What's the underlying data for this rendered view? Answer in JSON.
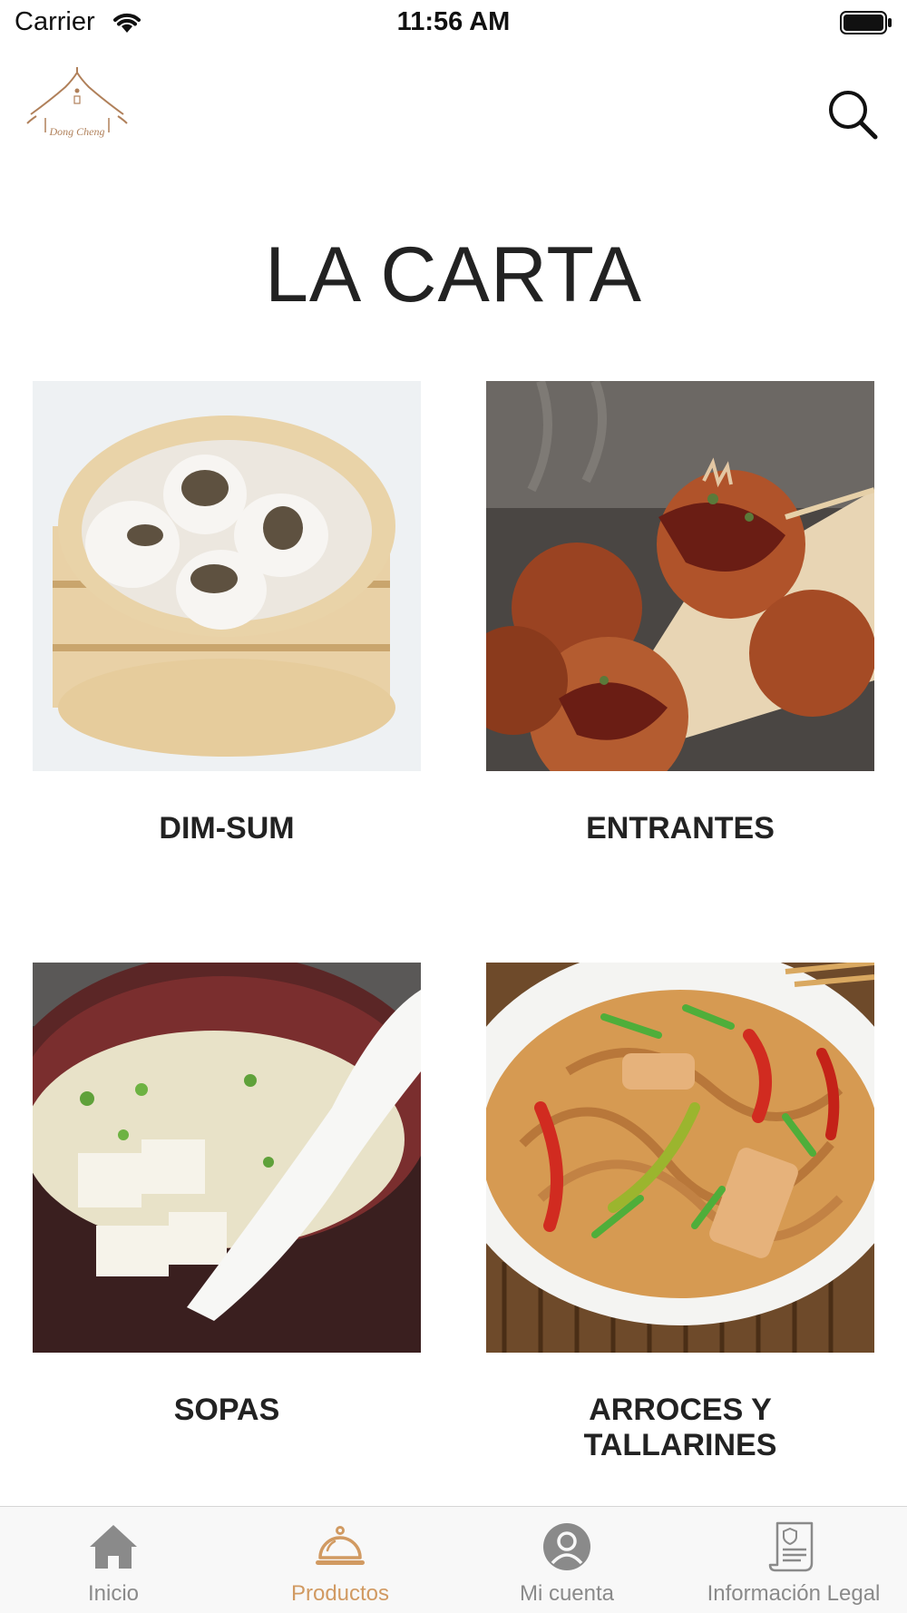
{
  "status_bar": {
    "carrier": "Carrier",
    "time": "11:56 AM",
    "wifi_icon": "wifi-icon",
    "battery_icon": "battery-full-icon"
  },
  "header": {
    "logo_text": "Dong Cheng",
    "search_icon": "search-icon"
  },
  "page": {
    "title": "LA CARTA"
  },
  "categories": [
    {
      "label": "DIM-SUM"
    },
    {
      "label": "ENTRANTES"
    },
    {
      "label": "SOPAS"
    },
    {
      "label": "ARROCES Y TALLARINES"
    }
  ],
  "tab_bar": {
    "active_color": "#d19a62",
    "inactive_color": "#8a8a8a",
    "tabs": [
      {
        "label": "Inicio",
        "icon": "home-icon",
        "active": false
      },
      {
        "label": "Productos",
        "icon": "cloche-icon",
        "active": true
      },
      {
        "label": "Mi cuenta",
        "icon": "user-icon",
        "active": false
      },
      {
        "label": "Información Legal",
        "icon": "legal-document-icon",
        "active": false
      }
    ]
  }
}
